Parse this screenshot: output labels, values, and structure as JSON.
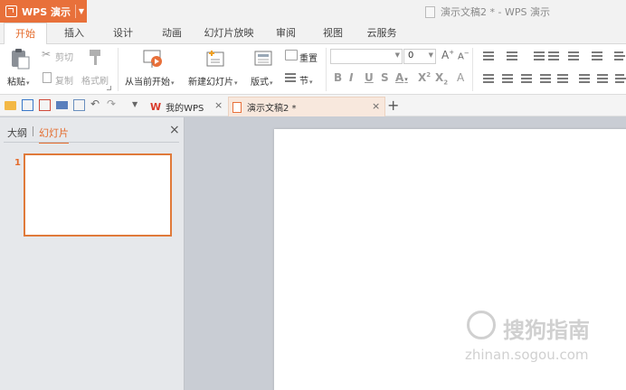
{
  "app": {
    "name": "WPS 演示",
    "window_title": "演示文稿2 * - WPS 演示"
  },
  "tabs": [
    "开始",
    "插入",
    "设计",
    "动画",
    "幻灯片放映",
    "审阅",
    "视图",
    "云服务"
  ],
  "ribbon": {
    "paste": "粘贴",
    "cut": "剪切",
    "copy": "复制",
    "format_painter": "格式刷",
    "play_from_current": "从当前开始",
    "new_slide": "新建幻灯片",
    "layout": "版式",
    "reset": "重置",
    "section": "节",
    "font_size": "0"
  },
  "doc_tabs": {
    "mywps": "我的WPS",
    "current": "演示文稿2 *"
  },
  "left_pane": {
    "outline_tab": "大纲",
    "slides_tab": "幻灯片",
    "slide_number": "1"
  },
  "watermark": {
    "brand": "搜狗指南",
    "url": "zhinan.sogou.com"
  },
  "colors": {
    "accent": "#e8703a"
  }
}
